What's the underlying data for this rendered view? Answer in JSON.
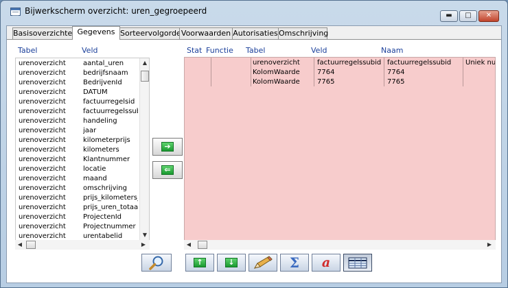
{
  "window": {
    "title": "Bijwerkscherm overzicht: uren_gegroepeerd",
    "min_glyph": "▬",
    "max_glyph": "□",
    "close_glyph": "✕"
  },
  "tabs": [
    {
      "label": "Basisoverzichten"
    },
    {
      "label": "Gegevens"
    },
    {
      "label": "Sorteervolgorde"
    },
    {
      "label": "Voorwaarden"
    },
    {
      "label": "Autorisaties"
    },
    {
      "label": "Omschrijving"
    }
  ],
  "active_tab": "Gegevens",
  "left_list": {
    "headers": {
      "tabel": "Tabel",
      "veld": "Veld"
    },
    "rows": [
      {
        "tabel": "urenoverzicht",
        "veld": "aantal_uren"
      },
      {
        "tabel": "urenoverzicht",
        "veld": "bedrijfsnaam"
      },
      {
        "tabel": "urenoverzicht",
        "veld": "BedrijvenId"
      },
      {
        "tabel": "urenoverzicht",
        "veld": "DATUM"
      },
      {
        "tabel": "urenoverzicht",
        "veld": "factuurregelsid"
      },
      {
        "tabel": "urenoverzicht",
        "veld": "factuurregelssubid"
      },
      {
        "tabel": "urenoverzicht",
        "veld": "handeling"
      },
      {
        "tabel": "urenoverzicht",
        "veld": "jaar"
      },
      {
        "tabel": "urenoverzicht",
        "veld": "kilometerprijs"
      },
      {
        "tabel": "urenoverzicht",
        "veld": "kilometers"
      },
      {
        "tabel": "urenoverzicht",
        "veld": "Klantnummer"
      },
      {
        "tabel": "urenoverzicht",
        "veld": "locatie"
      },
      {
        "tabel": "urenoverzicht",
        "veld": "maand"
      },
      {
        "tabel": "urenoverzicht",
        "veld": "omschrijving"
      },
      {
        "tabel": "urenoverzicht",
        "veld": "prijs_kilometers_t"
      },
      {
        "tabel": "urenoverzicht",
        "veld": "prijs_uren_totaal"
      },
      {
        "tabel": "urenoverzicht",
        "veld": "ProjectenId"
      },
      {
        "tabel": "urenoverzicht",
        "veld": "Projectnummer"
      },
      {
        "tabel": "urenoverzicht",
        "veld": "urentabelid"
      }
    ]
  },
  "right_grid": {
    "headers": {
      "stat": "Stat",
      "functie": "Functie",
      "tabel": "Tabel",
      "veld": "Veld",
      "naam": "Naam"
    },
    "rows": [
      {
        "stat": "",
        "functie": "",
        "tabel": "urenoverzicht",
        "veld": "factuurregelssubid",
        "naam": "factuurregelssubid",
        "extra": "Uniek nu"
      },
      {
        "stat": "",
        "functie": "",
        "tabel": "KolomWaarde",
        "veld": "7764",
        "naam": "7764",
        "extra": ""
      },
      {
        "stat": "",
        "functie": "",
        "tabel": "KolomWaarde",
        "veld": "7765",
        "naam": "7765",
        "extra": ""
      }
    ]
  },
  "buttons": {
    "add_arrow": "➔",
    "remove_arrow": "⇐",
    "up_arrow": "↑",
    "down_arrow": "↓",
    "sigma": "Σ",
    "a_letter": "a"
  },
  "colors": {
    "grid_background": "#f7cccc",
    "header_text": "#1a3f9a"
  }
}
